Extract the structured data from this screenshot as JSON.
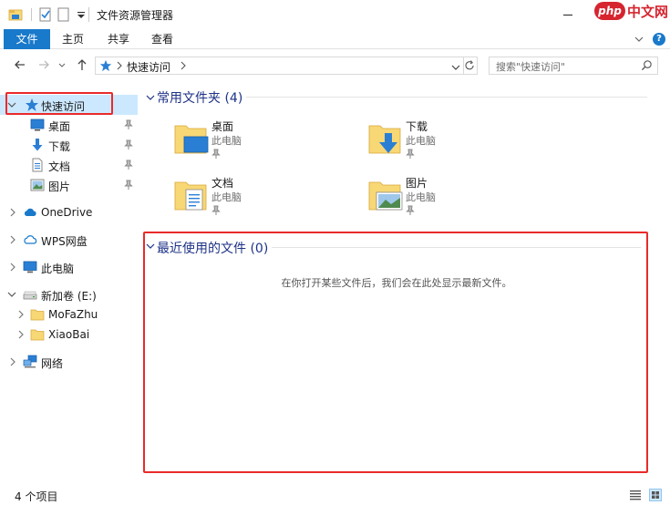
{
  "window": {
    "title": "文件资源管理器"
  },
  "watermark": {
    "badge": "php",
    "text": "中文网"
  },
  "ribbon": {
    "tabs": [
      {
        "label": "文件",
        "active": true
      },
      {
        "label": "主页"
      },
      {
        "label": "共享"
      },
      {
        "label": "查看"
      }
    ],
    "help": "?"
  },
  "address": {
    "path": "快速访问",
    "search_placeholder": "搜索\"快速访问\""
  },
  "nav": {
    "quick_access": "快速访问",
    "pinned": [
      {
        "label": "桌面",
        "icon": "desktop-icon"
      },
      {
        "label": "下载",
        "icon": "download-icon"
      },
      {
        "label": "文档",
        "icon": "document-icon"
      },
      {
        "label": "图片",
        "icon": "picture-icon"
      }
    ],
    "onedrive": "OneDrive",
    "wps": "WPS网盘",
    "this_pc": "此电脑",
    "drive": "新加卷 (E:)",
    "folders": [
      "MoFaZhu",
      "XiaoBai"
    ],
    "network": "网络"
  },
  "content": {
    "frequent_header": "常用文件夹 (4)",
    "frequent": [
      {
        "name": "桌面",
        "location": "此电脑",
        "icon": "desktop-folder-icon"
      },
      {
        "name": "下载",
        "location": "此电脑",
        "icon": "download-folder-icon"
      },
      {
        "name": "文档",
        "location": "此电脑",
        "icon": "documents-folder-icon"
      },
      {
        "name": "图片",
        "location": "此电脑",
        "icon": "pictures-folder-icon"
      }
    ],
    "recent_header": "最近使用的文件 (0)",
    "recent_empty": "在你打开某些文件后，我们会在此处显示最新文件。"
  },
  "status": {
    "items": "4 个项目"
  },
  "colors": {
    "accent": "#1979ca",
    "highlight_box": "#ea2a2a",
    "selection": "#cce8ff",
    "header_text": "#1e3287",
    "folder": "#f8d775"
  }
}
